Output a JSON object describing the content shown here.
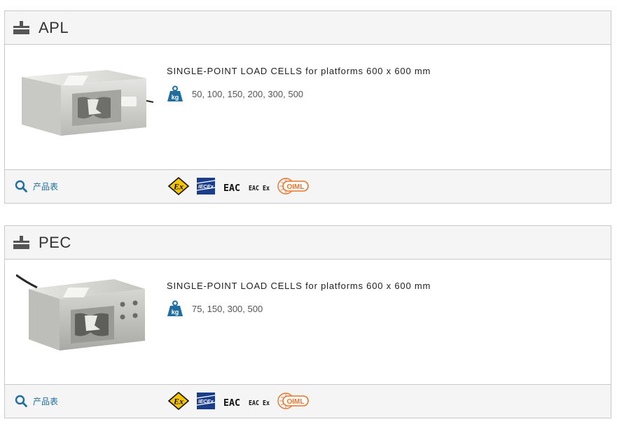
{
  "accent_color": "#1f6e9e",
  "products": [
    {
      "name": "APL",
      "description": "SINGLE-POINT LOAD CELLS for platforms 600 x 600 mm",
      "capacities": "50, 100, 150, 200, 300, 500",
      "datasheet_label": "产品表",
      "certifications": {
        "atex": "Ex",
        "iecex": "IECEx",
        "eac": "EAC",
        "eac_ex": "EAC Ex",
        "oiml": "OIML"
      }
    },
    {
      "name": "PEC",
      "description": "SINGLE-POINT LOAD CELLS for platforms 600 x 600 mm",
      "capacities": "75, 150, 300, 500",
      "datasheet_label": "产品表",
      "certifications": {
        "atex": "Ex",
        "iecex": "IECEx",
        "eac": "EAC",
        "eac_ex": "EAC Ex",
        "oiml": "OIML"
      }
    }
  ],
  "icons": {
    "header": "scale-icon",
    "capacity": "kg-weight-icon",
    "datasheet": "search-icon"
  }
}
